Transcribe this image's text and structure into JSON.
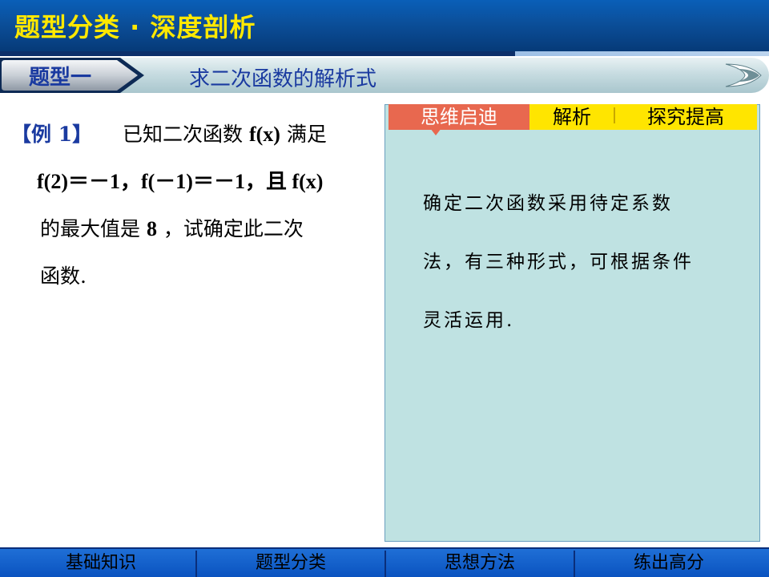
{
  "header": {
    "title": "题型分类 · 深度剖析"
  },
  "topic": {
    "tab_label": "题型一",
    "title": "求二次函数的解析式"
  },
  "question": {
    "tag": "【例 1】",
    "line1_text": "已知二次函数 ",
    "line1_math": "f(x)",
    "line1_end": "满足",
    "line2": "f(2)＝－1，f(－1)＝－1，且 f(x)",
    "line3_a": "的最大值是 ",
    "line3_num": "8",
    "line3_b": "，试确定此二次",
    "line4": "函数."
  },
  "panel": {
    "tabs": [
      "思维启迪",
      "解析",
      "探究提高"
    ],
    "active_tab": "思维启迪",
    "lines": [
      "确定二次函数采用待定系数",
      "法，有三种形式，可根据条件",
      "灵活运用."
    ]
  },
  "bottom_nav": {
    "items": [
      "基础知识",
      "题型分类",
      "思想方法",
      "练出高分"
    ]
  },
  "colors": {
    "header_blue": "#0b4f9a",
    "title_yellow": "#ffe800",
    "accent_red": "#e8684f",
    "tab_yellow": "#ffe500",
    "panel_bg": "#bfe2e2",
    "nav_blue": "#0a53c0"
  }
}
